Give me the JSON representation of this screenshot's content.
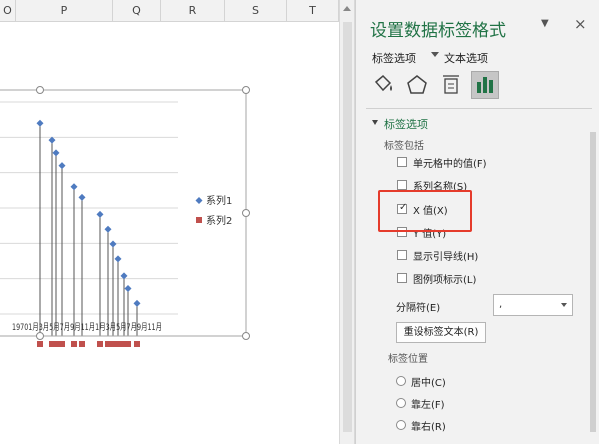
{
  "sheet": {
    "columns": [
      {
        "label": "O"
      },
      {
        "label": "P"
      },
      {
        "label": "Q"
      },
      {
        "label": "R"
      },
      {
        "label": "S"
      },
      {
        "label": "T"
      }
    ]
  },
  "chart_data": {
    "type": "line",
    "series": [
      {
        "name": "系列1",
        "color": "#4f7bc0",
        "marker": "diamond"
      },
      {
        "name": "系列2",
        "color": "#c0504d",
        "marker": "square"
      }
    ],
    "series1_values": [
      0.9,
      0.82,
      0.76,
      0.7,
      0.6,
      0.55,
      0.47,
      0.4,
      0.33,
      0.26,
      0.18,
      0.12,
      0.05
    ],
    "x_axis_text": "19701月3月5月7月9月11月1月3月5月7月9月11月",
    "legend_position": "right",
    "gridlines": true
  },
  "pane": {
    "title": "设置数据标签格式",
    "dropdown_icon": "▼",
    "close_icon": "×",
    "tab_label_options": "标签选项",
    "tab_text_options": "文本选项",
    "section_title": "标签选项",
    "label_contains_title": "标签包括",
    "options": [
      {
        "text": "单元格中的值(F)",
        "checked": false
      },
      {
        "text": "系列名称(S)",
        "checked": false
      },
      {
        "text": "X 值(X)",
        "checked": true
      },
      {
        "text": "Y 值(Y)",
        "checked": false
      },
      {
        "text": "显示引导线(H)",
        "checked": false
      },
      {
        "text": "图例项标示(L)",
        "checked": false
      }
    ],
    "checkmark": "✓",
    "separator_label": "分隔符(E)",
    "separator_value": ",",
    "reset_button": "重设标签文本(R)",
    "position_title": "标签位置",
    "positions": [
      {
        "text": "居中(C)"
      },
      {
        "text": "靠左(F)"
      },
      {
        "text": "靠右(R)"
      }
    ]
  }
}
